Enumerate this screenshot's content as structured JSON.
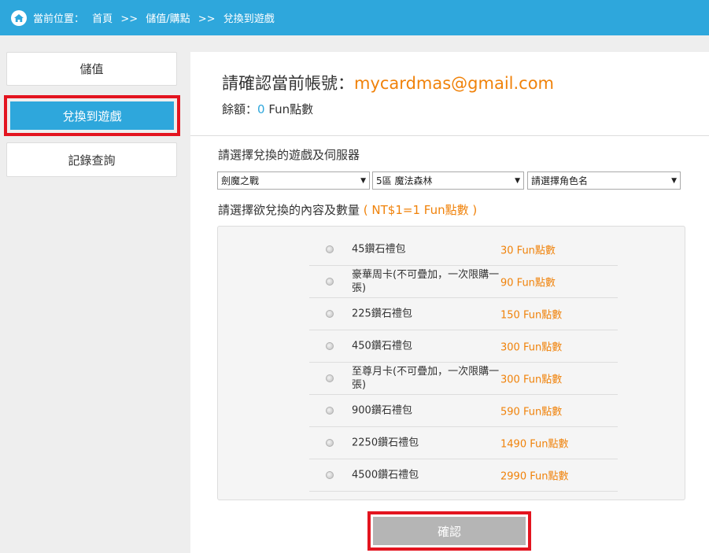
{
  "breadcrumb": {
    "label": "當前位置：",
    "items": [
      "首頁",
      ">>",
      "儲值/購點",
      ">>",
      "兌換到遊戲"
    ]
  },
  "sidebar": {
    "items": [
      {
        "label": "儲值"
      },
      {
        "label": "兌換到遊戲"
      },
      {
        "label": "記錄查詢"
      }
    ]
  },
  "account": {
    "title": "請確認當前帳號：",
    "email": "mycardmas@gmail.com",
    "balance_label": "餘額：",
    "balance_value": "0",
    "balance_unit": "Fun點數"
  },
  "selection": {
    "label": "請選擇兌換的遊戲及伺服器",
    "game": "劍魔之戰",
    "server": "5區 魔法森林",
    "role": "請選擇角色名"
  },
  "content": {
    "label": "請選擇欲兌換的內容及數量",
    "rate": "( NT$1=1 Fun點數 )",
    "items": [
      {
        "name": "45鑽石禮包",
        "price": "30 Fun點數"
      },
      {
        "name": "豪華周卡(不可疊加，一次限購一張)",
        "price": "90 Fun點數"
      },
      {
        "name": "225鑽石禮包",
        "price": "150 Fun點數"
      },
      {
        "name": "450鑽石禮包",
        "price": "300 Fun點數"
      },
      {
        "name": "至尊月卡(不可疊加，一次限購一張)",
        "price": "300 Fun點數"
      },
      {
        "name": "900鑽石禮包",
        "price": "590 Fun點數"
      },
      {
        "name": "2250鑽石禮包",
        "price": "1490 Fun點數"
      },
      {
        "name": "4500鑽石禮包",
        "price": "2990 Fun點數"
      }
    ]
  },
  "confirm_label": "確認",
  "colors": {
    "accent_blue": "#2ea7dc",
    "accent_orange": "#f0820a",
    "highlight_red": "#e3141f",
    "button_gray": "#b5b5b5"
  },
  "icons": {
    "home": "home-icon",
    "dropdown": "chevron-down-icon",
    "radio": "radio-button"
  }
}
